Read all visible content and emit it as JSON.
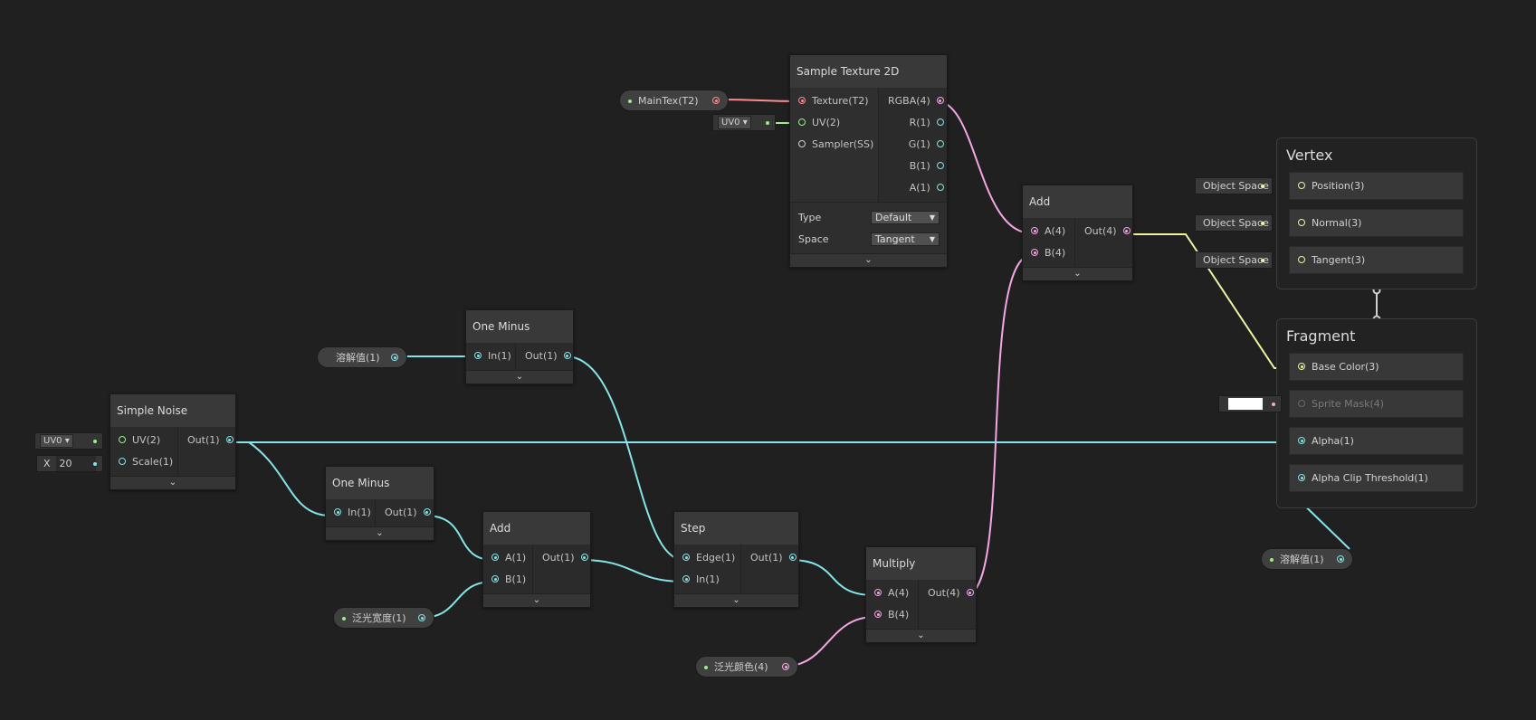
{
  "nodes": {
    "sample_texture": {
      "title": "Sample Texture 2D",
      "inputs": [
        "Texture(T2)",
        "UV(2)",
        "Sampler(SS)"
      ],
      "outputs": [
        "RGBA(4)",
        "R(1)",
        "G(1)",
        "B(1)",
        "A(1)"
      ],
      "type_label": "Type",
      "type_value": "Default",
      "space_label": "Space",
      "space_value": "Tangent"
    },
    "add_top": {
      "title": "Add",
      "inputs": [
        "A(4)",
        "B(4)"
      ],
      "outputs": [
        "Out(4)"
      ]
    },
    "one_minus_top": {
      "title": "One Minus",
      "inputs": [
        "In(1)"
      ],
      "outputs": [
        "Out(1)"
      ]
    },
    "simple_noise": {
      "title": "Simple Noise",
      "inputs": [
        "UV(2)",
        "Scale(1)"
      ],
      "outputs": [
        "Out(1)"
      ]
    },
    "one_minus_bottom": {
      "title": "One Minus",
      "inputs": [
        "In(1)"
      ],
      "outputs": [
        "Out(1)"
      ]
    },
    "add_bottom": {
      "title": "Add",
      "inputs": [
        "A(1)",
        "B(1)"
      ],
      "outputs": [
        "Out(1)"
      ]
    },
    "step": {
      "title": "Step",
      "inputs": [
        "Edge(1)",
        "In(1)"
      ],
      "outputs": [
        "Out(1)"
      ]
    },
    "multiply": {
      "title": "Multiply",
      "inputs": [
        "A(4)",
        "B(4)"
      ],
      "outputs": [
        "Out(4)"
      ]
    }
  },
  "properties": {
    "main_tex": "MainTex(T2)",
    "dissolve_1": "溶解值(1)",
    "dissolve_2": "溶解值(1)",
    "glow_width": "泛光宽度(1)",
    "glow_color": "泛光颜色(4)"
  },
  "inline_inputs": {
    "uv_sample": "UV0",
    "uv_noise": "UV0",
    "scale_axis": "X",
    "scale_value": "20"
  },
  "master": {
    "vertex": {
      "title": "Vertex",
      "blocks": [
        "Position(3)",
        "Normal(3)",
        "Tangent(3)"
      ],
      "space_labels": [
        "Object Space",
        "Object Space",
        "Object Space"
      ]
    },
    "fragment": {
      "title": "Fragment",
      "blocks": [
        "Base Color(3)",
        "Sprite Mask(4)",
        "Alpha(1)",
        "Alpha Clip Threshold(1)"
      ]
    }
  },
  "colors": {
    "float_port": "#84e4e7",
    "vector4_port": "#f5a6e4",
    "texture_port": "#ff8b8b",
    "vector3_port": "#f0f3a1",
    "vector2_port": "#9bee89",
    "background": "#202020"
  },
  "icons": {
    "expander": "chevron-down-icon",
    "dropdown": "caret-down-icon"
  },
  "expander_glyph": "⌄"
}
